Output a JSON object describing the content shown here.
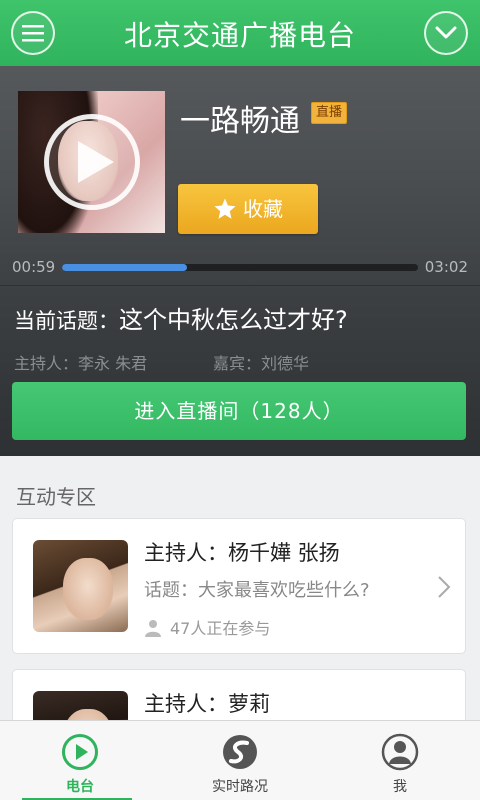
{
  "header": {
    "title": "北京交通广播电台",
    "menu_icon": "menu-icon",
    "dropdown_icon": "chevron-down-icon"
  },
  "player": {
    "show_name": "一路畅通",
    "badge": "直播",
    "favorite_label": "收藏",
    "time_current": "00:59",
    "time_total": "03:02",
    "progress_fraction": 0.35,
    "topic_label": "当前话题：",
    "topic_text": "这个中秋怎么过才好?",
    "hosts": "主持人：李永  朱君",
    "guest": "嘉宾：刘德华",
    "enter_label": "进入直播间（128人）"
  },
  "interaction": {
    "title": "互动专区",
    "cards": [
      {
        "host": "主持人：杨千嬅  张扬",
        "topic": "话题：大家最喜欢吃些什么?",
        "count": "47人正在参与"
      },
      {
        "host": "主持人：萝莉"
      }
    ]
  },
  "tabs": [
    {
      "label": "电台",
      "icon": "play-circle-icon",
      "active": true
    },
    {
      "label": "实时路况",
      "icon": "road-icon",
      "active": false
    },
    {
      "label": "我",
      "icon": "user-icon",
      "active": false
    }
  ],
  "colors": {
    "brand_green": "#2fb35c",
    "favorite_yellow": "#f2b33c",
    "progress_blue": "#4a90e2"
  }
}
